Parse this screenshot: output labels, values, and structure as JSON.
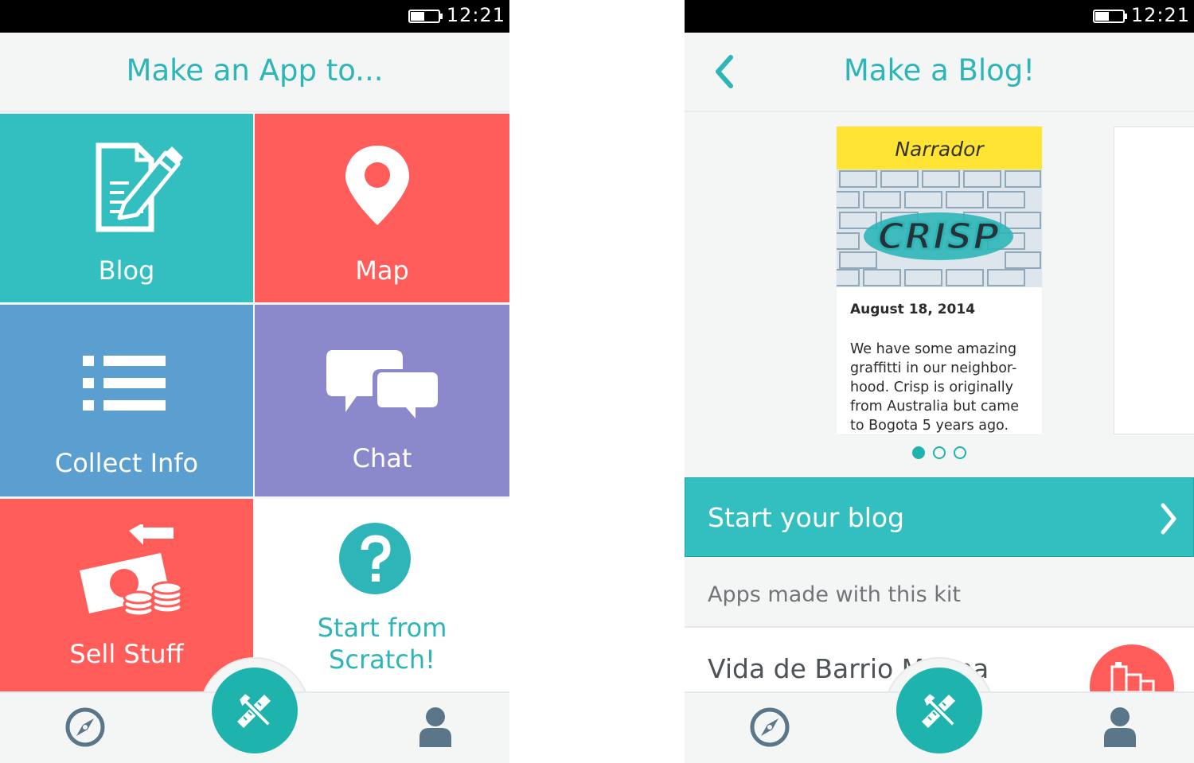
{
  "status_bar": {
    "time": "12:21"
  },
  "screen_left": {
    "title": "Make an App to...",
    "tiles": [
      {
        "label": "Blog",
        "icon": "blog-edit-icon",
        "color": "#33bfbf"
      },
      {
        "label": "Map",
        "icon": "map-pin-icon",
        "color": "#ff5c5a"
      },
      {
        "label": "Collect Info",
        "icon": "list-icon",
        "color": "#5a9fd0"
      },
      {
        "label": "Chat",
        "icon": "chat-bubbles-icon",
        "color": "#8b88cc"
      },
      {
        "label": "Sell Stuff",
        "icon": "money-icon",
        "color": "#ff5c5a"
      },
      {
        "label_line1": "Start from",
        "label_line2": "Scratch!",
        "icon": "question-icon",
        "color": "#2eb5b8"
      }
    ]
  },
  "screen_right": {
    "title": "Make a Blog!",
    "carousel": {
      "card": {
        "header": "Narrador",
        "image_text": "CRISP",
        "date": "August 18, 2014",
        "body_lines": [
          "We have some amazing",
          "graffitti in our neighbor-",
          "hood. Crisp is originally",
          "from Australia but came",
          "to Bogota 5 years ago."
        ]
      },
      "page_count": 3,
      "active_page": 1
    },
    "start_button": "Start your blog",
    "section_title": "Apps made with this kit",
    "list_item": "Vida de Barrio M   lena"
  },
  "bottom_nav": {
    "left_icon": "compass-icon",
    "center_icon": "tools-icon",
    "right_icon": "profile-icon"
  },
  "colors": {
    "accent": "#2eb5b8",
    "teal": "#33bfbf",
    "coral": "#ff5c5a",
    "blue": "#5a9fd0",
    "purple": "#8b88cc"
  }
}
